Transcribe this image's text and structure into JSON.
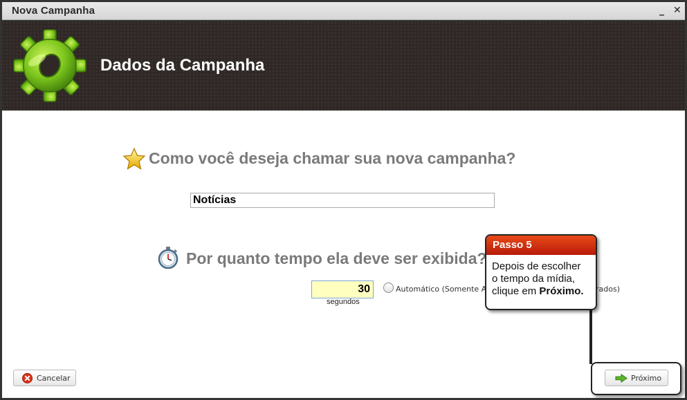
{
  "window": {
    "title": "Nova Campanha",
    "minimize_glyph": "_",
    "close_glyph": "✕"
  },
  "banner": {
    "title": "Dados da Campanha",
    "icon": "gear-icon"
  },
  "form": {
    "name_question": "Como você deseja chamar sua nova campanha?",
    "name_value": "Notícias",
    "duration_question": "Por quanto tempo ela deve ser exibida?",
    "duration_value": "30",
    "duration_unit": "segundos",
    "auto_option_label": "Automático (Somente Arqu",
    "auto_option_label_tail": "rados)"
  },
  "buttons": {
    "cancel": "Cancelar",
    "next": "Próximo"
  },
  "callout": {
    "title": "Passo 5",
    "text_line1": "Depois de escolher",
    "text_line2": "o tempo da mídia,",
    "text_line3_prefix": "clique em ",
    "text_line3_bold": "Próximo."
  },
  "colors": {
    "banner_bg": "#2f2826",
    "question_text": "#7a7a7a",
    "callout_header": "#d0310f",
    "seconds_bg": "#ffffc0"
  }
}
